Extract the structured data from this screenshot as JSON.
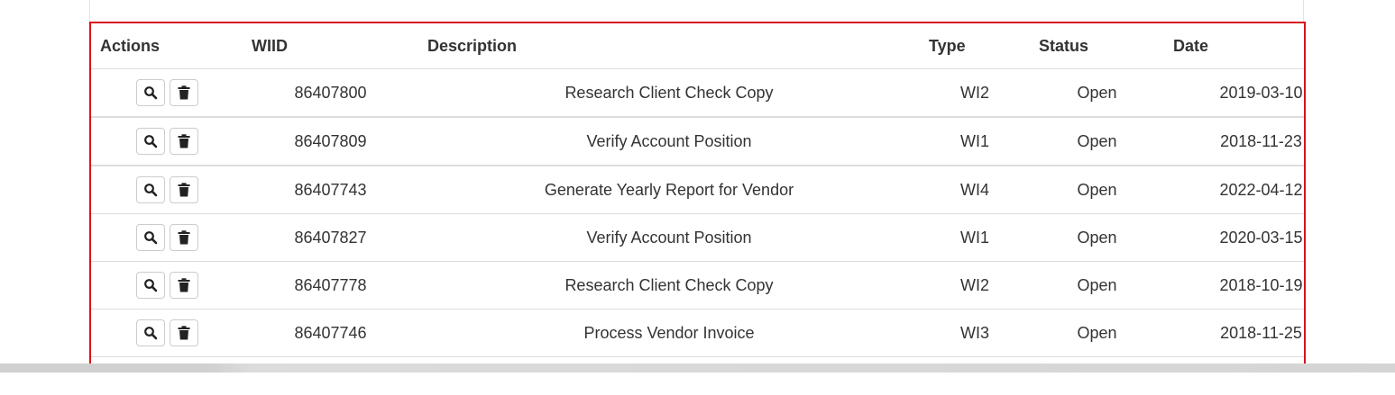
{
  "table": {
    "headers": {
      "actions": "Actions",
      "wiid": "WIID",
      "description": "Description",
      "type": "Type",
      "status": "Status",
      "date": "Date"
    },
    "rows": [
      {
        "wiid": "86407800",
        "description": "Research Client Check Copy",
        "type": "WI2",
        "status": "Open",
        "date": "2019-03-10"
      },
      {
        "wiid": "86407809",
        "description": "Verify Account Position",
        "type": "WI1",
        "status": "Open",
        "date": "2018-11-23"
      },
      {
        "wiid": "86407743",
        "description": "Generate Yearly Report for Vendor",
        "type": "WI4",
        "status": "Open",
        "date": "2022-04-12"
      },
      {
        "wiid": "86407827",
        "description": "Verify Account Position",
        "type": "WI1",
        "status": "Open",
        "date": "2020-03-15"
      },
      {
        "wiid": "86407778",
        "description": "Research Client Check Copy",
        "type": "WI2",
        "status": "Open",
        "date": "2018-10-19"
      },
      {
        "wiid": "86407746",
        "description": "Process Vendor Invoice",
        "type": "WI3",
        "status": "Open",
        "date": "2018-11-25"
      }
    ],
    "row_actions": [
      "search-icon",
      "trash-icon"
    ],
    "highlight_color": "#d9121b"
  }
}
